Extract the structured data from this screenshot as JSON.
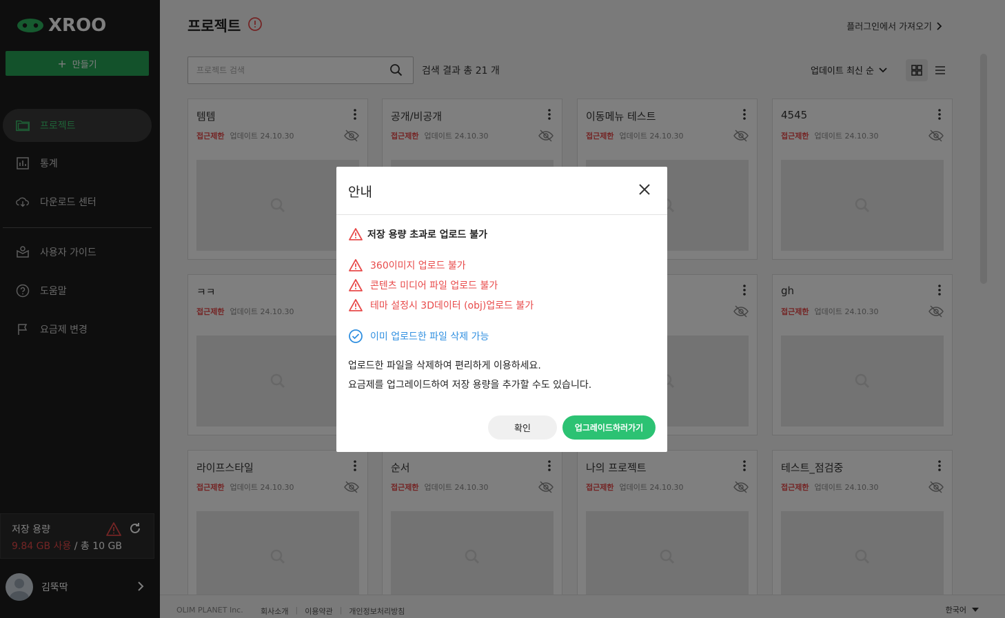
{
  "sidebar": {
    "logo_text": "XROO",
    "create_label": "만들기",
    "nav": [
      {
        "label": "프로젝트",
        "icon": "folder-icon"
      },
      {
        "label": "통계",
        "icon": "chart-icon"
      },
      {
        "label": "다운로드 센터",
        "icon": "cloud-download-icon"
      },
      {
        "label": "사용자 가이드",
        "icon": "guide-icon"
      },
      {
        "label": "도움말",
        "icon": "question-icon"
      },
      {
        "label": "요금제 변경",
        "icon": "flag-icon"
      }
    ],
    "storage": {
      "title": "저장 용량",
      "used": "9.84 GB 사용",
      "total": " / 총 10 GB"
    },
    "user": {
      "name": "김뚝딱"
    }
  },
  "header": {
    "title": "프로젝트",
    "plugin_link": "플러그인에서 가져오기",
    "search_placeholder": "프로젝트 검색",
    "result_count": "검색 결과 총 21 개",
    "sort_label": "업데이트 최신 순"
  },
  "cards": [
    {
      "title": "템템",
      "restricted": "접근제한",
      "updated": "업데이트 24.10.30"
    },
    {
      "title": "공개/비공개",
      "restricted": "접근제한",
      "updated": "업데이트 24.10.30"
    },
    {
      "title": "이동메뉴 테스트",
      "restricted": "접근제한",
      "updated": "업데이트 24.10.30"
    },
    {
      "title": "4545",
      "restricted": "접근제한",
      "updated": "업데이트 24.10.30"
    },
    {
      "title": "ㅋㅋ",
      "restricted": "접근제한",
      "updated": "업데이트 24.10.30"
    },
    {
      "title": "",
      "restricted": "",
      "updated": ""
    },
    {
      "title": "",
      "restricted": "",
      "updated": "30"
    },
    {
      "title": "gh",
      "restricted": "접근제한",
      "updated": "업데이트 24.10.30"
    },
    {
      "title": "라이프스타일",
      "restricted": "접근제한",
      "updated": "업데이트 24.10.30"
    },
    {
      "title": "순서",
      "restricted": "접근제한",
      "updated": "업데이트 24.10.30"
    },
    {
      "title": "나의 프로젝트",
      "restricted": "접근제한",
      "updated": "업데이트 24.10.30"
    },
    {
      "title": "테스트_점검중",
      "restricted": "접근제한",
      "updated": "업데이트 24.10.30"
    }
  ],
  "footer": {
    "company": "OLIM PLANET Inc.",
    "links": [
      "회사소개",
      "이용약관",
      "개인정보처리방침"
    ],
    "language": "한국어"
  },
  "modal": {
    "title": "안내",
    "heading": "저장 용량 초과로 업로드 불가",
    "warnings": [
      "360이미지 업로드 불가",
      "콘텐츠 미디어 파일 업로드 불가",
      "테마 설정시 3D데이터 (obj)업로드 불가"
    ],
    "ok": "이미 업로드한 파일 삭제 가능",
    "desc1": "업로드한 파일을 삭제하여 편리하게 이용하세요.",
    "desc2": "요금제를 업그레이드하여 저장 용량을 추가할 수도 있습니다.",
    "confirm": "확인",
    "upgrade": "업그레이드하러가기"
  },
  "colors": {
    "brand": "#27a556",
    "warning": "#e84a4a",
    "info": "#2f8fe0",
    "upgrade": "#2cc273"
  }
}
